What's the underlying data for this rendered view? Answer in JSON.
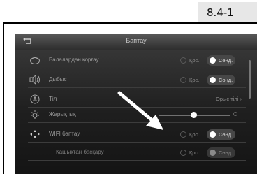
{
  "page_label": "8.4-1",
  "screen": {
    "title": "Баптау",
    "settings": [
      {
        "label": "Балалардан қорғау",
        "icon": "child-lock-icon",
        "off": "Қос.",
        "on": "Сөнд."
      },
      {
        "label": "Дыбыс",
        "icon": "speaker-icon",
        "off": "Қос.",
        "on": "Сөнд."
      },
      {
        "label": "Тіл",
        "icon": "language-icon",
        "value": "Орыс тілі"
      },
      {
        "label": "Жарықтық",
        "icon": "brightness-icon",
        "brightness": 0.45
      },
      {
        "label": "WIFI баптау",
        "icon": "wifi-icon",
        "off": "Қос.",
        "on": "Сөнд."
      },
      {
        "label": "Қашықтан басқару",
        "off": "Қос.",
        "on": "Сөнд."
      }
    ]
  },
  "colors": {
    "screen_bg": "#1f1f1f",
    "arrow": "#ffffff"
  }
}
